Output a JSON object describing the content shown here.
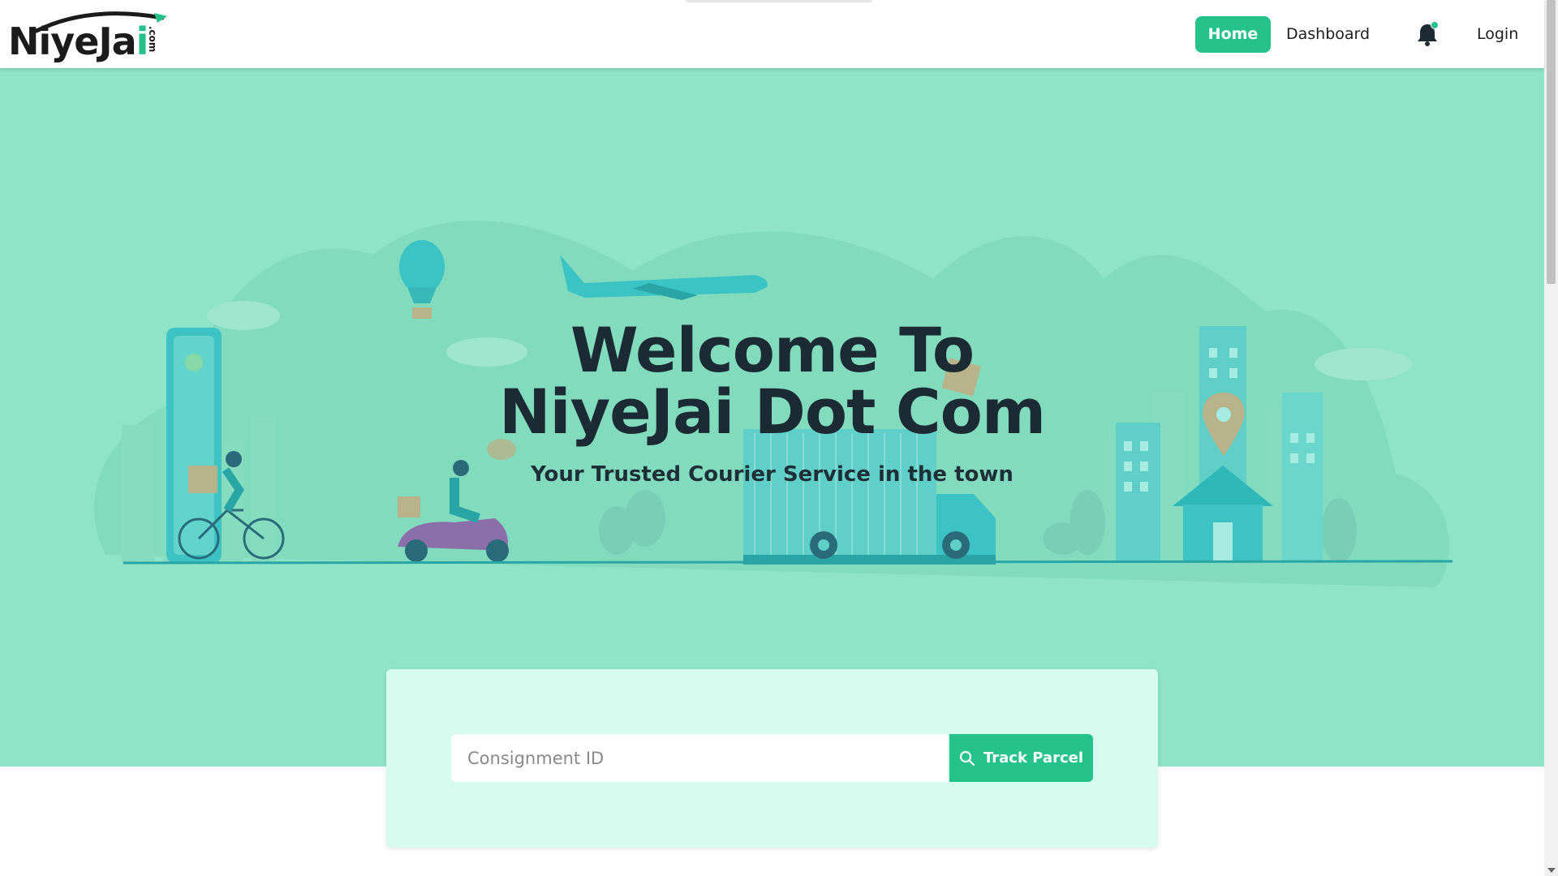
{
  "brand": {
    "logo_main": "NiyeJa",
    "logo_accent": "i",
    "logo_suffix": ".com",
    "accent_color": "#25c38b"
  },
  "nav": {
    "home_label": "Home",
    "dashboard_label": "Dashboard",
    "login_label": "Login",
    "bell_icon": "bell-icon"
  },
  "hero": {
    "title_line1": "Welcome To",
    "title_line2": "NiyeJai Dot Com",
    "subtitle": "Your Trusted Courier Service in the town",
    "background_color": "#8fe3c7"
  },
  "tracking": {
    "input_placeholder": "Consignment ID",
    "input_value": "",
    "button_label": "Track Parcel",
    "button_icon": "search-icon"
  }
}
